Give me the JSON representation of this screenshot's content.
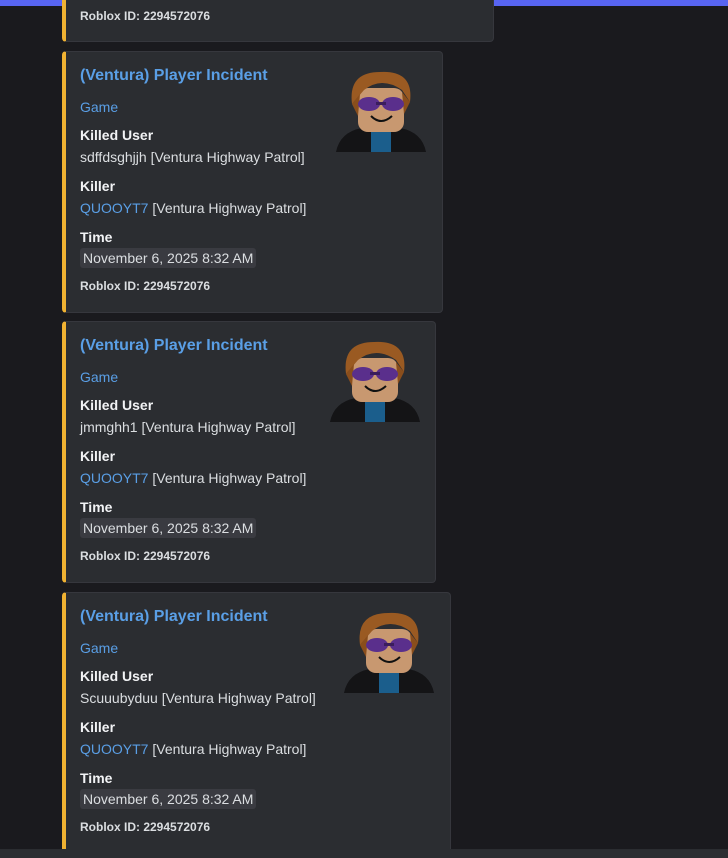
{
  "partial_embed": {
    "footer": "Roblox ID: 2294572076"
  },
  "embeds": [
    {
      "title": "(Ventura) Player Incident",
      "author": "Game",
      "killed_user_label": "Killed User",
      "killed_user_value": "sdffdsghjjh [Ventura Highway Patrol]",
      "killer_label": "Killer",
      "killer_name": "QUOOYT7",
      "killer_team": " [Ventura Highway Patrol]",
      "time_label": "Time",
      "time_value": "November 6, 2025 8:32 AM",
      "footer": "Roblox ID: 2294572076",
      "thumbnail_icon": "roblox-avatar-icon"
    },
    {
      "title": "(Ventura) Player Incident",
      "author": "Game",
      "killed_user_label": "Killed User",
      "killed_user_value": "jmmghh1 [Ventura Highway Patrol]",
      "killer_label": "Killer",
      "killer_name": "QUOOYT7",
      "killer_team": " [Ventura Highway Patrol]",
      "time_label": "Time",
      "time_value": "November 6, 2025 8:32 AM",
      "footer": "Roblox ID: 2294572076",
      "thumbnail_icon": "roblox-avatar-icon"
    },
    {
      "title": "(Ventura) Player Incident",
      "author": "Game",
      "killed_user_label": "Killed User",
      "killed_user_value": "Scuuubyduu [Ventura Highway Patrol]",
      "killer_label": "Killer",
      "killer_name": "QUOOYT7",
      "killer_team": " [Ventura Highway Patrol]",
      "time_label": "Time",
      "time_value": "November 6, 2025 8:32 AM",
      "footer": "Roblox ID: 2294572076",
      "thumbnail_icon": "roblox-avatar-icon"
    }
  ],
  "colors": {
    "accent_bar": "#f0b232",
    "link": "#5a9fe6",
    "embed_bg": "#2b2d31",
    "page_bg": "#1a1a1e",
    "top_bar": "#5865f2"
  }
}
